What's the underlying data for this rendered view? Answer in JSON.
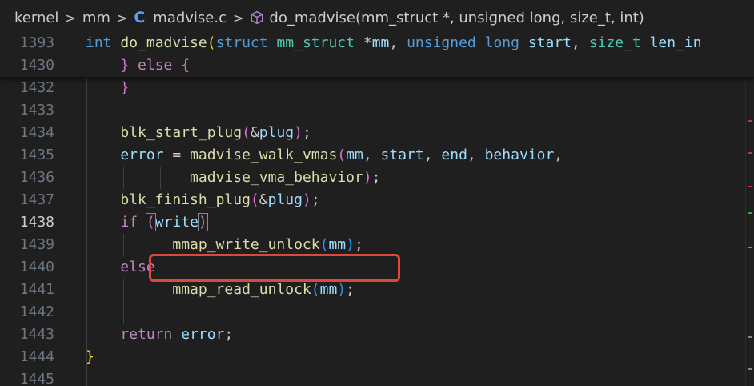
{
  "breadcrumb": {
    "items": [
      "kernel",
      "mm",
      "madvise.c",
      "do_madvise(mm_struct *, unsigned long, size_t, int)"
    ],
    "separator": ">"
  },
  "colors": {
    "background": "#1f1f1f",
    "highlight_box": "#e2453c"
  },
  "sticky": [
    {
      "num": "1393",
      "tokens": [
        {
          "t": "int",
          "c": "kw"
        },
        {
          "t": " ",
          "c": ""
        },
        {
          "t": "do_madvise",
          "c": "fn"
        },
        {
          "t": "(",
          "c": "br1"
        },
        {
          "t": "struct",
          "c": "kw"
        },
        {
          "t": " ",
          "c": ""
        },
        {
          "t": "mm_struct",
          "c": "ty"
        },
        {
          "t": " *",
          "c": ""
        },
        {
          "t": "mm",
          "c": "var"
        },
        {
          "t": ", ",
          "c": ""
        },
        {
          "t": "unsigned",
          "c": "kw"
        },
        {
          "t": " ",
          "c": ""
        },
        {
          "t": "long",
          "c": "kw"
        },
        {
          "t": " ",
          "c": ""
        },
        {
          "t": "start",
          "c": "var"
        },
        {
          "t": ", ",
          "c": ""
        },
        {
          "t": "size_t",
          "c": "ty"
        },
        {
          "t": " ",
          "c": ""
        },
        {
          "t": "len_in",
          "c": "var"
        }
      ]
    },
    {
      "num": "1430",
      "tokens": [
        {
          "t": "    ",
          "c": ""
        },
        {
          "t": "}",
          "c": "br2"
        },
        {
          "t": " ",
          "c": ""
        },
        {
          "t": "else",
          "c": "ctl"
        },
        {
          "t": " ",
          "c": ""
        },
        {
          "t": "{",
          "c": "br2"
        }
      ]
    }
  ],
  "lines": [
    {
      "num": "1432",
      "tokens": [
        {
          "t": "    ",
          "c": ""
        },
        {
          "t": "}",
          "c": "br2"
        }
      ]
    },
    {
      "num": "1433",
      "tokens": []
    },
    {
      "num": "1434",
      "tokens": [
        {
          "t": "    ",
          "c": ""
        },
        {
          "t": "blk_start_plug",
          "c": "fn"
        },
        {
          "t": "(",
          "c": "br2"
        },
        {
          "t": "&",
          "c": ""
        },
        {
          "t": "plug",
          "c": "var"
        },
        {
          "t": ")",
          "c": "br2"
        },
        {
          "t": ";",
          "c": ""
        }
      ]
    },
    {
      "num": "1435",
      "tokens": [
        {
          "t": "    ",
          "c": ""
        },
        {
          "t": "error",
          "c": "var"
        },
        {
          "t": " = ",
          "c": ""
        },
        {
          "t": "madvise_walk_vmas",
          "c": "fn"
        },
        {
          "t": "(",
          "c": "br2"
        },
        {
          "t": "mm",
          "c": "var"
        },
        {
          "t": ", ",
          "c": ""
        },
        {
          "t": "start",
          "c": "var"
        },
        {
          "t": ", ",
          "c": ""
        },
        {
          "t": "end",
          "c": "var"
        },
        {
          "t": ", ",
          "c": ""
        },
        {
          "t": "behavior",
          "c": "var"
        },
        {
          "t": ",",
          "c": ""
        }
      ]
    },
    {
      "num": "1436",
      "tokens": [
        {
          "t": "            ",
          "c": ""
        },
        {
          "t": "madvise_vma_behavior",
          "c": "fn"
        },
        {
          "t": ")",
          "c": "br2"
        },
        {
          "t": ";",
          "c": ""
        }
      ]
    },
    {
      "num": "1437",
      "tokens": [
        {
          "t": "    ",
          "c": ""
        },
        {
          "t": "blk_finish_plug",
          "c": "fn"
        },
        {
          "t": "(",
          "c": "br2"
        },
        {
          "t": "&",
          "c": ""
        },
        {
          "t": "plug",
          "c": "var"
        },
        {
          "t": ")",
          "c": "br2"
        },
        {
          "t": ";",
          "c": ""
        }
      ]
    },
    {
      "num": "1438",
      "active": true,
      "tokens": [
        {
          "t": "    ",
          "c": ""
        },
        {
          "t": "if",
          "c": "ctl"
        },
        {
          "t": " ",
          "c": ""
        },
        {
          "t": "(",
          "c": "br2 bracket-match"
        },
        {
          "t": "write",
          "c": "var"
        },
        {
          "t": ")",
          "c": "br2 bracket-match"
        }
      ]
    },
    {
      "num": "1439",
      "tokens": [
        {
          "t": "          ",
          "c": ""
        },
        {
          "t": "mmap_write_unlock",
          "c": "fn"
        },
        {
          "t": "(",
          "c": "br3"
        },
        {
          "t": "mm",
          "c": "var"
        },
        {
          "t": ")",
          "c": "br3"
        },
        {
          "t": ";",
          "c": ""
        }
      ]
    },
    {
      "num": "1440",
      "tokens": [
        {
          "t": "    ",
          "c": ""
        },
        {
          "t": "else",
          "c": "ctl"
        }
      ]
    },
    {
      "num": "1441",
      "tokens": [
        {
          "t": "          ",
          "c": ""
        },
        {
          "t": "mmap_read_unlock",
          "c": "fn"
        },
        {
          "t": "(",
          "c": "br3"
        },
        {
          "t": "mm",
          "c": "var"
        },
        {
          "t": ")",
          "c": "br3"
        },
        {
          "t": ";",
          "c": ""
        }
      ]
    },
    {
      "num": "1442",
      "tokens": []
    },
    {
      "num": "1443",
      "tokens": [
        {
          "t": "    ",
          "c": ""
        },
        {
          "t": "return",
          "c": "ctl"
        },
        {
          "t": " ",
          "c": ""
        },
        {
          "t": "error",
          "c": "var"
        },
        {
          "t": ";",
          "c": ""
        }
      ]
    },
    {
      "num": "1444",
      "tokens": [
        {
          "t": "}",
          "c": "br1"
        }
      ]
    },
    {
      "num": "1445",
      "tokens": []
    }
  ]
}
